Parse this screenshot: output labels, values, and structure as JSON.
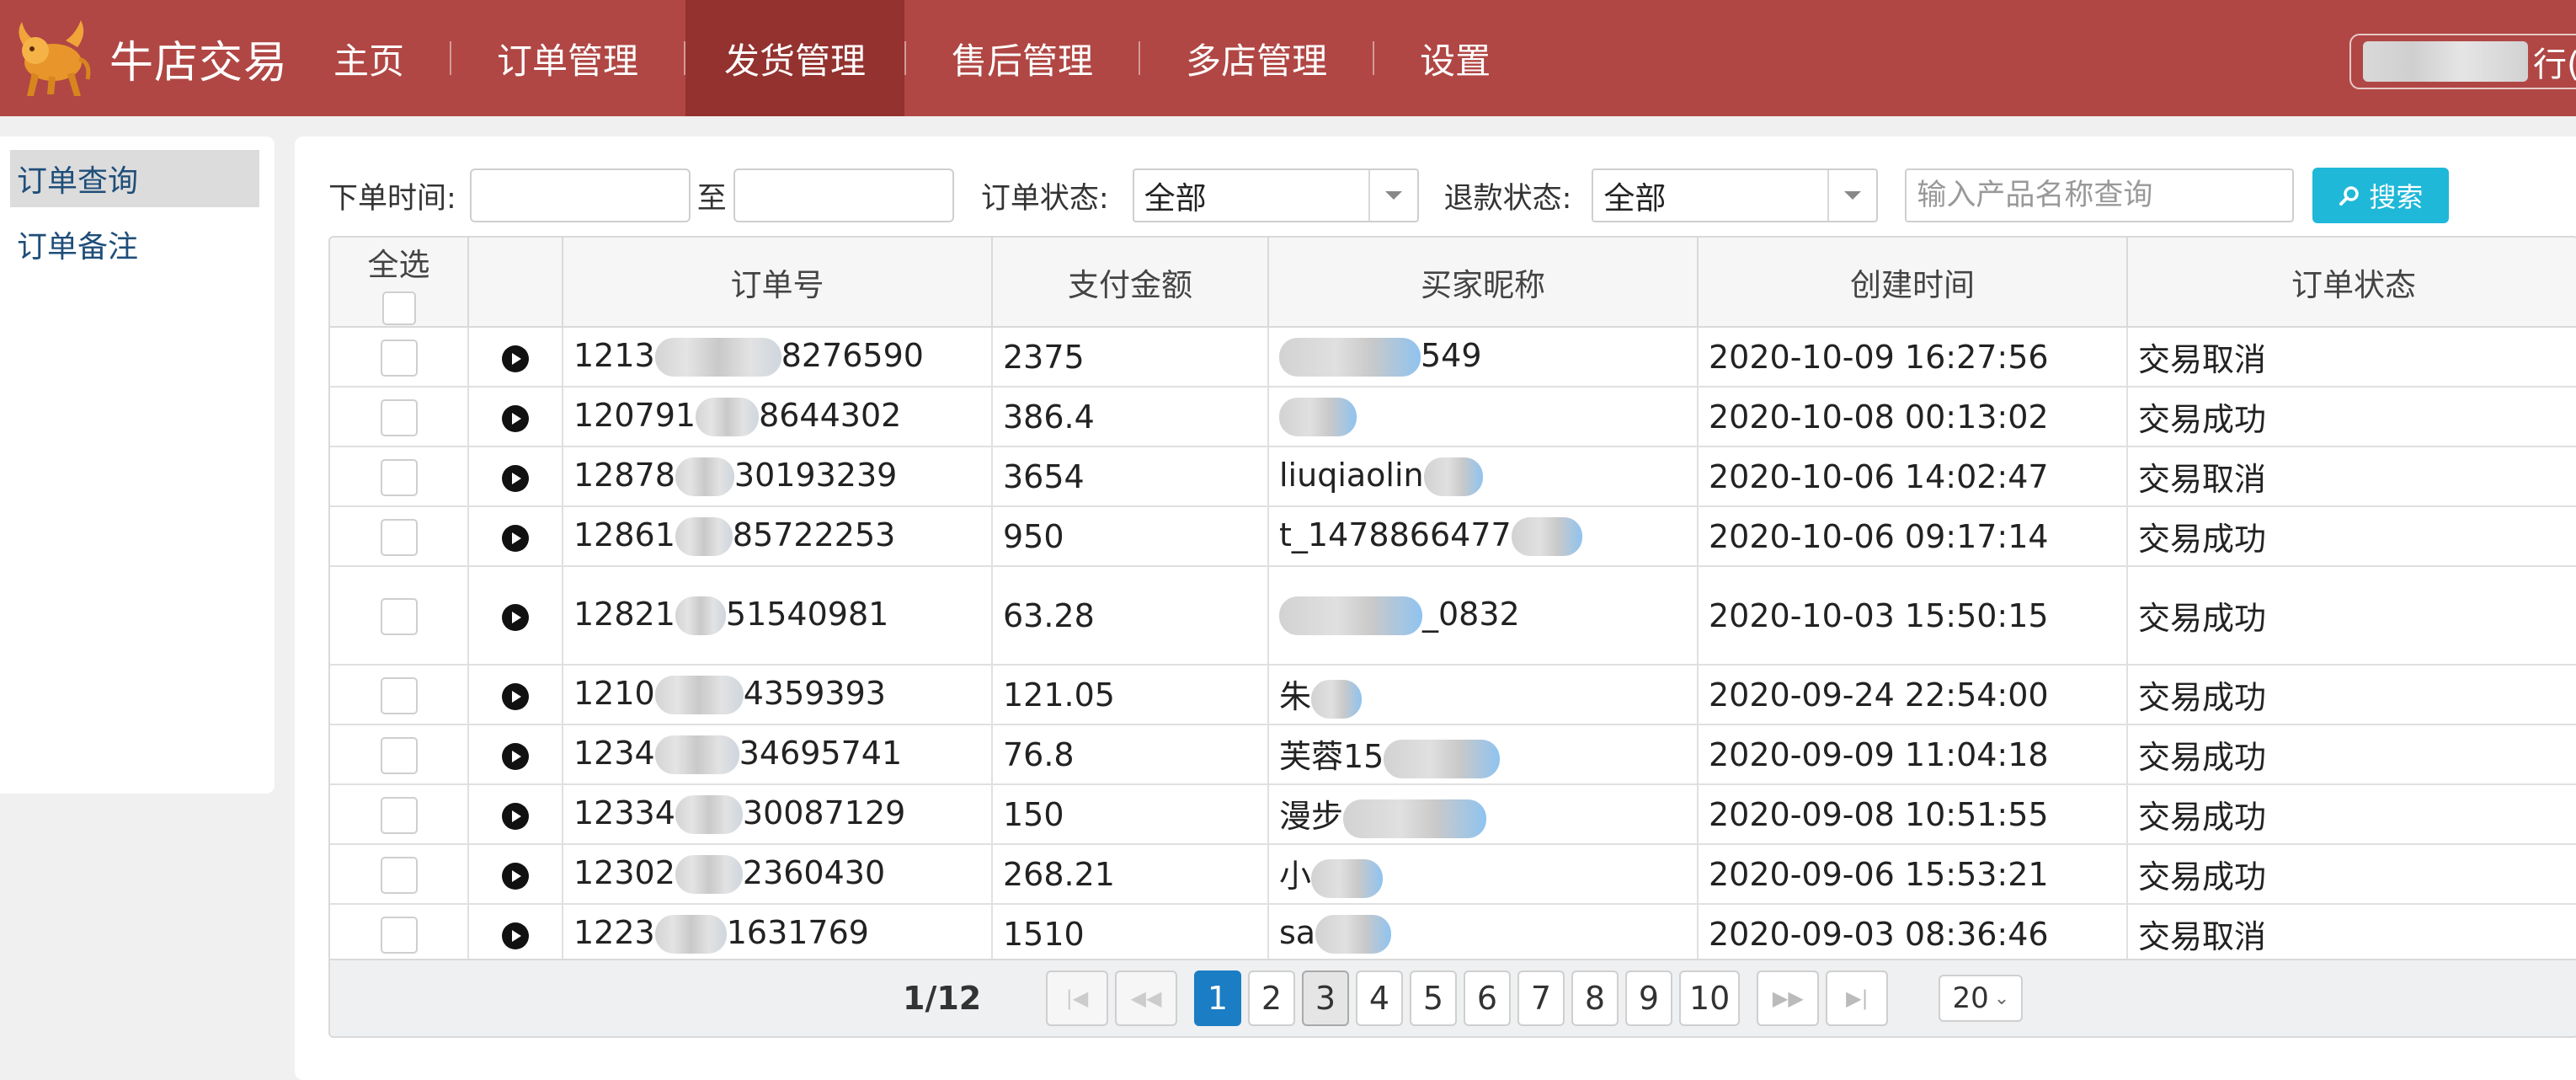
{
  "app": {
    "logo_text": "牛店交易",
    "brand_color": "#b04744",
    "active_nav_color": "#93322f"
  },
  "nav": {
    "items": [
      {
        "label": "主页"
      },
      {
        "label": "订单管理"
      },
      {
        "label": "发货管理",
        "active": true
      },
      {
        "label": "售后管理"
      },
      {
        "label": "多店管理"
      },
      {
        "label": "设置"
      }
    ]
  },
  "user": {
    "name_suffix": "行("
  },
  "sidebar": {
    "items": [
      {
        "label": "订单查询",
        "active": true
      },
      {
        "label": "订单备注"
      }
    ]
  },
  "filter": {
    "order_time_label": "下单时间:",
    "to_label": "至",
    "start_value": "",
    "end_value": "",
    "order_status_label": "订单状态:",
    "order_status_value": "全部",
    "refund_status_label": "退款状态:",
    "refund_status_value": "全部",
    "search_placeholder": "输入产品名称查询",
    "search_button": "搜索",
    "search_button_color": "#1fb8d8"
  },
  "table": {
    "select_all_label": "全选",
    "columns": [
      "订单号",
      "支付金额",
      "买家昵称",
      "创建时间",
      "订单状态"
    ],
    "rows": [
      {
        "order_prefix": "1213",
        "order_suffix": "8276590",
        "amount": "2375",
        "buyer_prefix": "",
        "buyer_suffix": "549",
        "created": "2020-10-09 16:27:56",
        "status": "交易取消"
      },
      {
        "order_prefix": "120791",
        "order_suffix": "8644302",
        "amount": "386.4",
        "buyer_prefix": "",
        "buyer_suffix": "",
        "created": "2020-10-08 00:13:02",
        "status": "交易成功"
      },
      {
        "order_prefix": "12878",
        "order_suffix": "30193239",
        "amount": "3654",
        "buyer_prefix": "liuqiaolin",
        "buyer_suffix": "",
        "created": "2020-10-06 14:02:47",
        "status": "交易取消"
      },
      {
        "order_prefix": "12861",
        "order_suffix": "85722253",
        "amount": "950",
        "buyer_prefix": "t_1478866477",
        "buyer_suffix": "",
        "created": "2020-10-06 09:17:14",
        "status": "交易成功"
      },
      {
        "order_prefix": "12821",
        "order_suffix": "51540981",
        "amount": "63.28",
        "buyer_prefix": "",
        "buyer_suffix": "_0832",
        "created": "2020-10-03 15:50:15",
        "status": "交易成功"
      },
      {
        "order_prefix": "1210",
        "order_suffix": "4359393",
        "amount": "121.05",
        "buyer_prefix": "朱",
        "buyer_suffix": "",
        "created": "2020-09-24 22:54:00",
        "status": "交易成功"
      },
      {
        "order_prefix": "1234",
        "order_suffix": "34695741",
        "amount": "76.8",
        "buyer_prefix": "芙蓉15",
        "buyer_suffix": "",
        "created": "2020-09-09 11:04:18",
        "status": "交易成功"
      },
      {
        "order_prefix": "12334",
        "order_suffix": "30087129",
        "amount": "150",
        "buyer_prefix": "漫步",
        "buyer_suffix": "",
        "created": "2020-09-08 10:51:55",
        "status": "交易成功"
      },
      {
        "order_prefix": "12302",
        "order_suffix": "2360430",
        "amount": "268.21",
        "buyer_prefix": "小",
        "buyer_suffix": "",
        "created": "2020-09-06 15:53:21",
        "status": "交易成功"
      },
      {
        "order_prefix": "1223",
        "order_suffix": "1631769",
        "amount": "1510",
        "buyer_prefix": "sa",
        "buyer_suffix": "",
        "created": "2020-09-03 08:36:46",
        "status": "交易取消"
      }
    ]
  },
  "pagination": {
    "info": "1/12",
    "pages": [
      "1",
      "2",
      "3",
      "4",
      "5",
      "6",
      "7",
      "8",
      "9",
      "10"
    ],
    "current": "1",
    "page_size": "20",
    "current_color": "#1b7dc4"
  }
}
